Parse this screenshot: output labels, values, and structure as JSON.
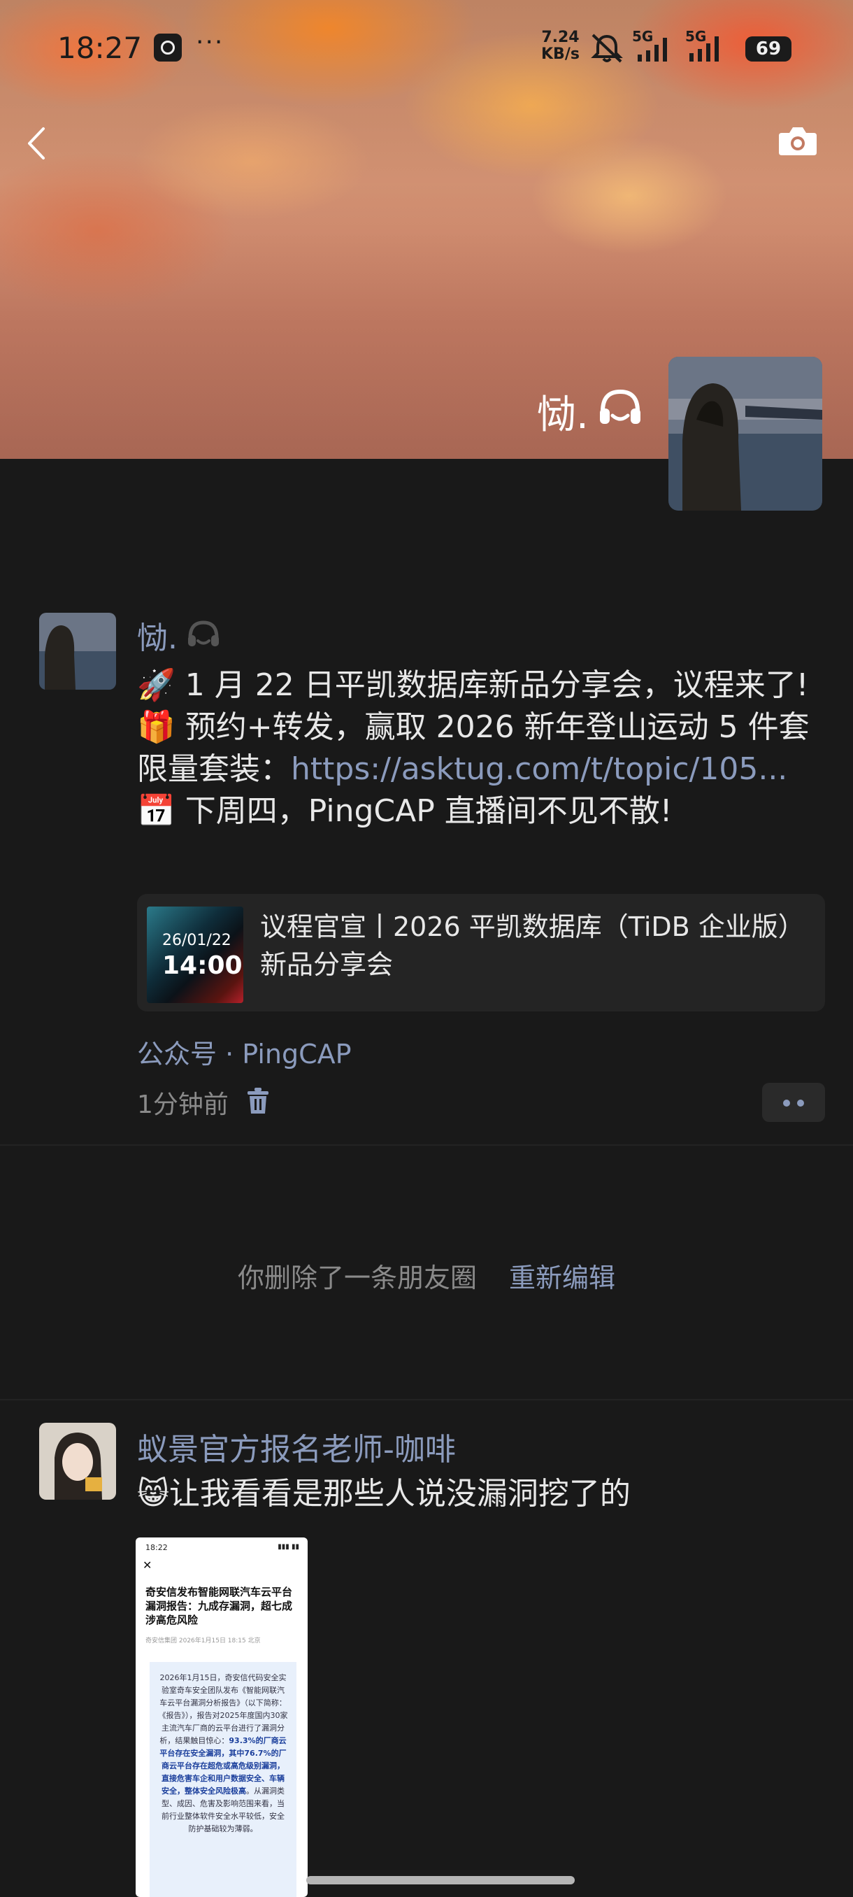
{
  "status_bar": {
    "time": "18:27",
    "dots": "···",
    "net_speed_value": "7.24",
    "net_speed_unit": "KB/s",
    "signal1": "5G",
    "signal2": "5G",
    "battery": "69"
  },
  "cover": {
    "name": "恸."
  },
  "post1": {
    "author": "恸.",
    "line1": "1 月 22 日平凯数据库新品分享会，议程来了!",
    "line2_prefix": "预约+转发，赢取 2026 新年登山运动 5 件套限量套装：",
    "line2_link": "https://asktug.com/t/topic/105...",
    "line3": "下周四，PingCAP 直播间不见不散!",
    "card": {
      "date": "26/01/22",
      "time": "14:00",
      "title": "议程官宣丨2026 平凯数据库（TiDB 企业版）新品分享会"
    },
    "source": "公众号 · PingCAP",
    "time_ago": "1分钟前"
  },
  "deleted_notice": {
    "text": "你删除了一条朋友圈",
    "action": "重新编辑"
  },
  "post2": {
    "author": "蚁景官方报名老师-咖啡",
    "text": "让我看看是那些人说没漏洞挖了的",
    "screenshot": {
      "time": "18:22",
      "title": "奇安信发布智能网联汽车云平台漏洞报告：九成存漏洞，超七成涉高危风险",
      "meta": "奇安信集团 2026年1月15日 18:15 北京",
      "body_plain": "2026年1月15日，奇安信代码安全实验室奇车安全团队发布《智能网联汽车云平台漏洞分析报告》（以下简称：《报告》），报告对2025年度国内30家主流汽车厂商的云平台进行了漏洞分析，结果触目惊心：",
      "body_bold": "93.3%的厂商云平台存在安全漏洞，其中76.7%的厂商云平台存在超危或高危级别漏洞，直接危害车企和用户数据安全、车辆安全，整体安全风险极高",
      "body_tail": "。从漏洞类型、成因、危害及影响范围来看，当前行业整体软件安全水平较低，安全防护基础较为薄弱。"
    }
  }
}
